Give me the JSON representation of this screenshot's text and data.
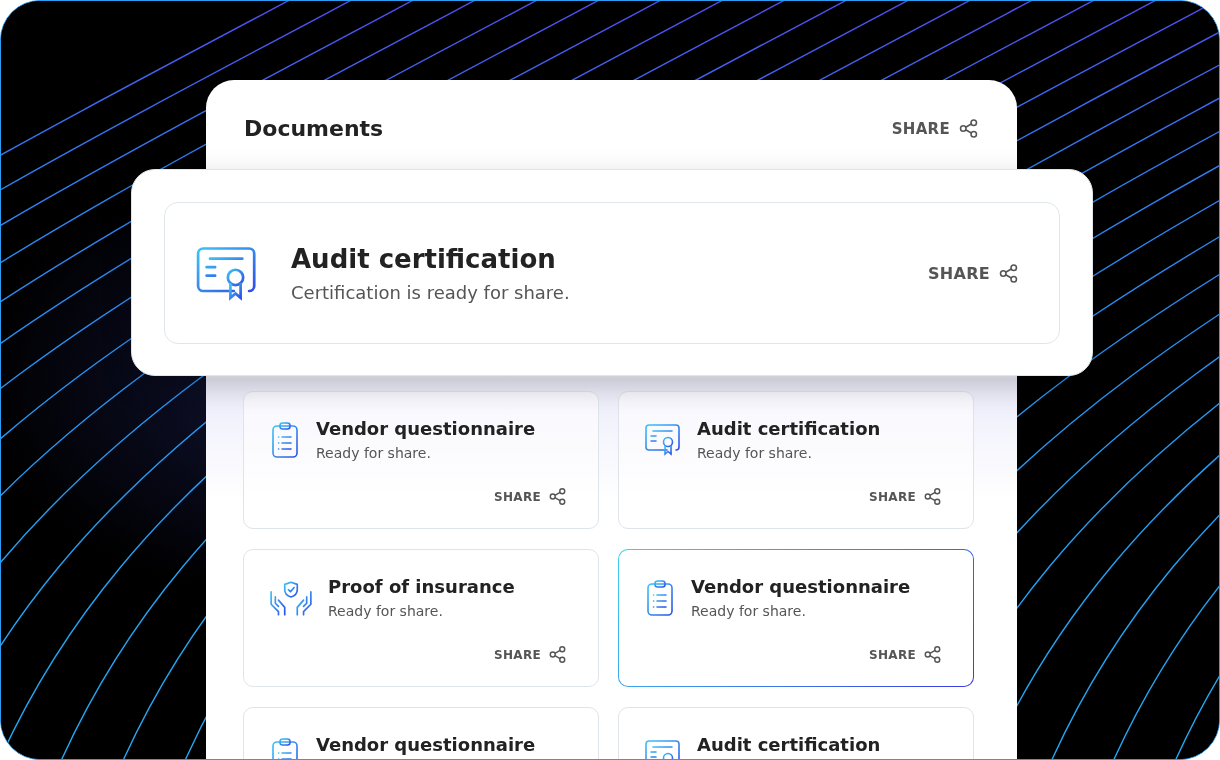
{
  "panel": {
    "title": "Documents",
    "share_label": "SHARE"
  },
  "featured": {
    "kind": "certificate",
    "title": "Audit certification",
    "subtitle": "Certification is ready for share.",
    "share_label": "SHARE"
  },
  "cards": [
    {
      "kind": "clipboard",
      "title": "Vendor questionnaire",
      "subtitle": "Ready for share.",
      "share_label": "SHARE",
      "selected": false
    },
    {
      "kind": "certificate",
      "title": "Audit certification",
      "subtitle": "Ready for share.",
      "share_label": "SHARE",
      "selected": false
    },
    {
      "kind": "insurance",
      "title": "Proof of insurance",
      "subtitle": "Ready for share.",
      "share_label": "SHARE",
      "selected": false
    },
    {
      "kind": "clipboard",
      "title": "Vendor questionnaire",
      "subtitle": "Ready for share.",
      "share_label": "SHARE",
      "selected": true
    },
    {
      "kind": "clipboard",
      "title": "Vendor questionnaire",
      "selected": false
    },
    {
      "kind": "certificate",
      "title": "Audit certification",
      "selected": false
    }
  ]
}
